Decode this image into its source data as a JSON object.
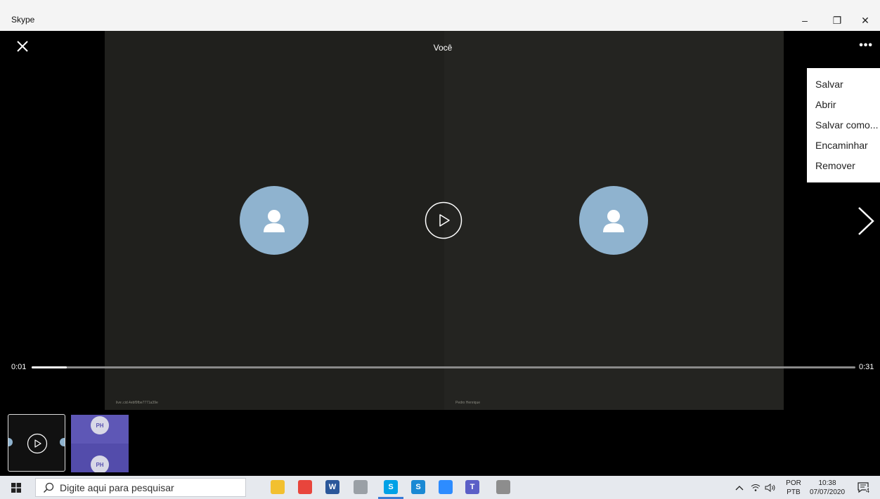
{
  "window": {
    "title": "Skype",
    "minimize": "–",
    "restore": "❐",
    "close": "✕"
  },
  "viewer": {
    "title": "Você",
    "more": "•••",
    "left_participant_tag": "live:.cid.4ebf9fbe7771a39e",
    "right_participant_tag": "Pedro Henrique",
    "elapsed": "0:01",
    "duration": "0:31",
    "progress": 0.043
  },
  "context_menu": {
    "items": [
      "Salvar",
      "Abrir",
      "Salvar como...",
      "Encaminhar",
      "Remover"
    ]
  },
  "thumbnails": {
    "second_initials_top": "PH",
    "second_initials_bottom": "PH"
  },
  "taskbar": {
    "search_placeholder": "Digite aqui para pesquisar",
    "apps": [
      {
        "name": "file-explorer",
        "label": "",
        "color": "#f2c030"
      },
      {
        "name": "chrome",
        "label": "",
        "color": "#e8453c"
      },
      {
        "name": "word",
        "label": "W",
        "color": "#2b579a"
      },
      {
        "name": "app-4",
        "label": "",
        "color": "#9aa0a6"
      },
      {
        "name": "skype-active",
        "label": "S",
        "color": "#00a1e6"
      },
      {
        "name": "skype-2",
        "label": "S",
        "color": "#1a89d4"
      },
      {
        "name": "zoom",
        "label": "",
        "color": "#2d8cff"
      },
      {
        "name": "teams",
        "label": "T",
        "color": "#5b5fc7"
      },
      {
        "name": "app-9",
        "label": "",
        "color": "#8d8d8d"
      }
    ],
    "lang_top": "POR",
    "lang_bottom": "PTB",
    "time": "10:38",
    "date": "07/07/2020",
    "notifications_count": "4"
  }
}
